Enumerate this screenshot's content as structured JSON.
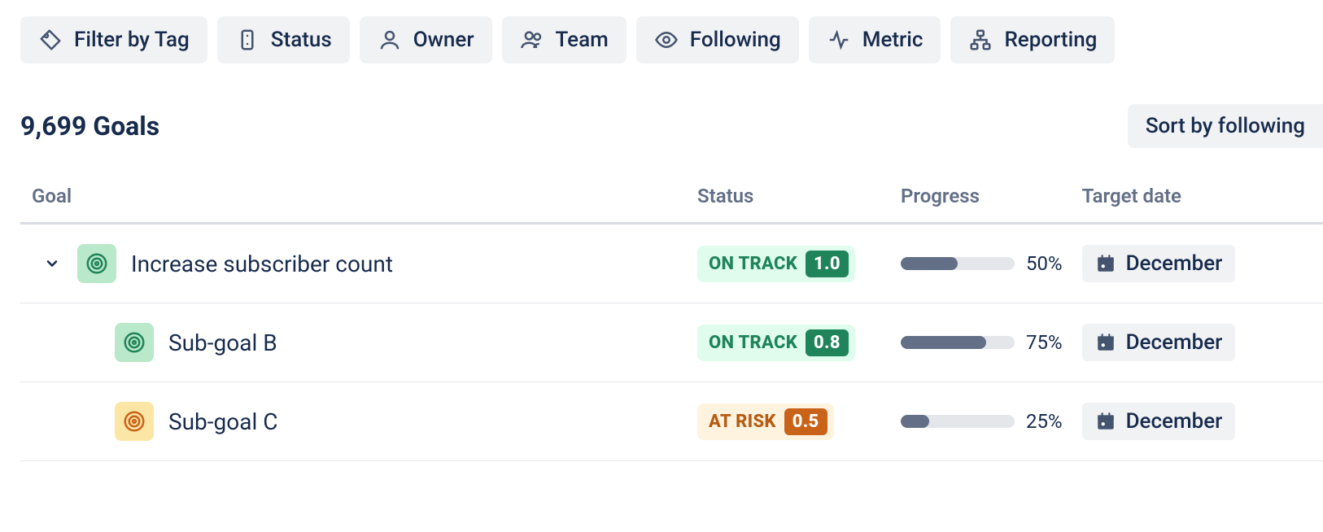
{
  "filters": {
    "tag": "Filter by Tag",
    "status": "Status",
    "owner": "Owner",
    "team": "Team",
    "following": "Following",
    "metric": "Metric",
    "reporting": "Reporting"
  },
  "summary": {
    "count_label": "9,699 Goals",
    "sort_label": "Sort by following"
  },
  "columns": {
    "goal": "Goal",
    "status": "Status",
    "progress": "Progress",
    "target_date": "Target date"
  },
  "rows": [
    {
      "name": "Increase subscriber count",
      "status_text": "ON TRACK",
      "score": "1.0",
      "progress_pct_label": "50%",
      "progress_pct": 50,
      "target_date": "December"
    },
    {
      "name": "Sub-goal B",
      "status_text": "ON TRACK",
      "score": "0.8",
      "progress_pct_label": "75%",
      "progress_pct": 75,
      "target_date": "December"
    },
    {
      "name": "Sub-goal C",
      "status_text": "AT RISK",
      "score": "0.5",
      "progress_pct_label": "25%",
      "progress_pct": 25,
      "target_date": "December"
    }
  ]
}
